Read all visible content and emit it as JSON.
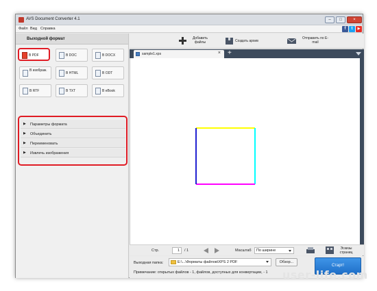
{
  "window": {
    "title": "AVS Document Converter 4.1"
  },
  "menu": [
    {
      "label": "Файл"
    },
    {
      "label": "Вид"
    },
    {
      "label": "Справка"
    }
  ],
  "social": {
    "facebook": "f",
    "twitter": "t",
    "youtube": "▶"
  },
  "sidebar": {
    "title": "Выходной формат",
    "formats": [
      {
        "label": "В PDF",
        "icon": "pdf-icon",
        "active": true
      },
      {
        "label": "В DOC",
        "icon": "doc-icon"
      },
      {
        "label": "В DOCX",
        "icon": "docx-icon"
      },
      {
        "label": "В изображ.",
        "icon": "image-icon"
      },
      {
        "label": "В HTML",
        "icon": "html-icon"
      },
      {
        "label": "В ODT",
        "icon": "odt-icon"
      },
      {
        "label": "В RTF",
        "icon": "rtf-icon"
      },
      {
        "label": "В TXT",
        "icon": "txt-icon"
      },
      {
        "label": "В eBook",
        "icon": "ebook-icon"
      }
    ],
    "params": [
      {
        "label": "Параметры формата"
      },
      {
        "label": "Объединить"
      },
      {
        "label": "Переименовать"
      },
      {
        "label": "Извлечь изображения"
      }
    ]
  },
  "toolbar": {
    "add_files": "Добавить файлы",
    "create_archive": "Создать архив",
    "send_email": "Отправить по E-mail"
  },
  "tab": {
    "label": "sample1.xps"
  },
  "nav": {
    "page_label": "Стр.",
    "page_current": "1",
    "page_total": "/ 1",
    "zoom_label": "Масштаб",
    "zoom_value": "По ширине",
    "thumbnails_label": "Эскизы страниц"
  },
  "bottom": {
    "output_label": "Выходная папка:",
    "output_path": "E:\\...\\Форматы файлов\\XPS 2 PDF",
    "browse_label": "Обзор...",
    "note": "Примечание: открытых файлов - 1, файлов, доступных для конвертации, - 1",
    "start_label": "Старт!"
  },
  "watermark": "user-life.com",
  "colors": {
    "accent": "#2a7bd8",
    "highlight_border": "#e01b24",
    "preview_yellow": "#ffff00",
    "preview_cyan": "#00ffff",
    "preview_magenta": "#ff00ff",
    "preview_blue": "#2020d0"
  }
}
